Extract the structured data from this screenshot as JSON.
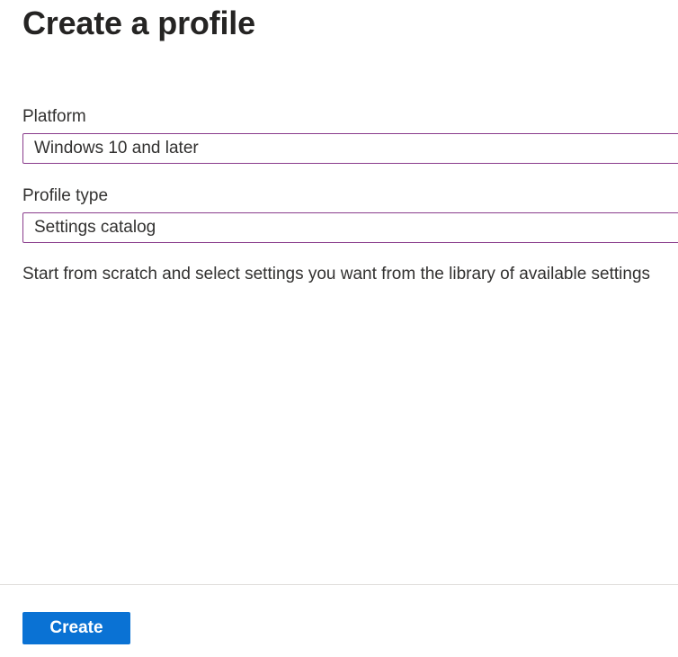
{
  "page": {
    "title": "Create a profile",
    "description": "Start from scratch and select settings you want from the library of available settings"
  },
  "fields": {
    "platform": {
      "label": "Platform",
      "value": "Windows 10 and later"
    },
    "profile_type": {
      "label": "Profile type",
      "value": "Settings catalog"
    }
  },
  "footer": {
    "create_label": "Create"
  },
  "colors": {
    "accent": "#0a72d4",
    "field_border": "#8a3c8c",
    "text": "#323130",
    "divider": "#e1dfdd"
  }
}
